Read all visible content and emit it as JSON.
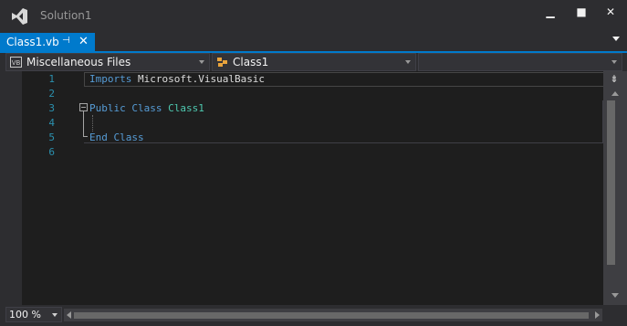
{
  "window": {
    "title": "Solution1",
    "min_glyph": "▁",
    "max_glyph": "■",
    "close_glyph": "✕"
  },
  "tab": {
    "label": "Class1.vb",
    "pin_glyph": "⊣",
    "close_glyph": "✕"
  },
  "navbar": {
    "files_dropdown": "Miscellaneous Files",
    "class_dropdown": "Class1",
    "member_dropdown": ""
  },
  "editor": {
    "line_numbers": [
      "1",
      "2",
      "3",
      "4",
      "5",
      "6"
    ],
    "lines": {
      "l1_kw": "Imports",
      "l1_rest": " Microsoft.VisualBasic",
      "l3_kw": "Public Class",
      "l3_type": " Class1",
      "l5_kw": "End Class"
    }
  },
  "scrollbar": {
    "split_glyph": "⇟"
  },
  "statusbar": {
    "zoom": "100 %"
  },
  "colors": {
    "accent": "#007acc",
    "keyword": "#569cd6",
    "type": "#4ec9b0",
    "line_number": "#2b91af",
    "editor_bg": "#1e1e1e",
    "chrome_bg": "#2d2d30"
  },
  "icons": {
    "app": "visual-studio-logo-icon",
    "file": "vb-file-icon",
    "class": "class-icon"
  }
}
